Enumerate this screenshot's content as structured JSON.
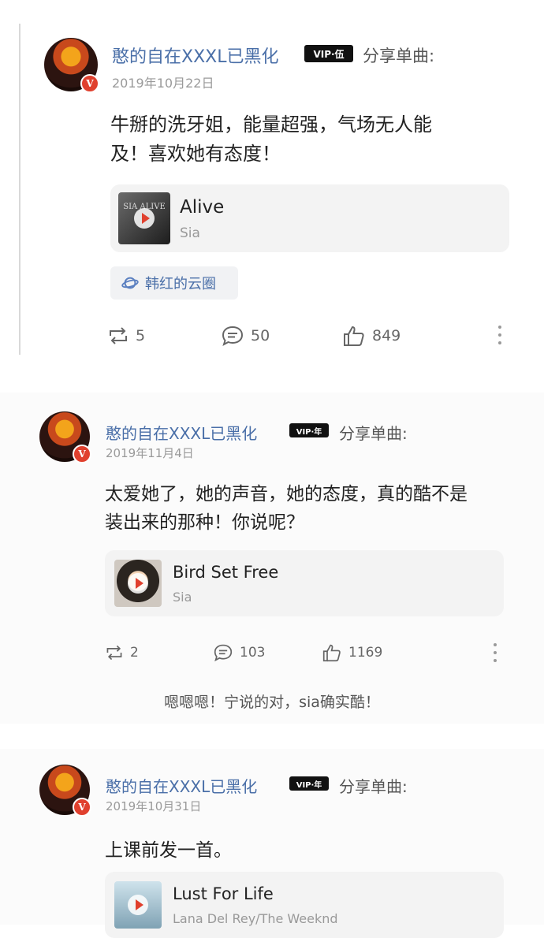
{
  "posts": [
    {
      "username": "憨的自在XXXL已黑化",
      "vip_badge": "VIP·伍",
      "action": "分享单曲:",
      "date": "2019年10月22日",
      "text_line1": "牛掰的洗牙姐，能量超强，气场无人能",
      "text_line2": "及！喜欢她有态度！",
      "song": {
        "title": "Alive",
        "artist": "Sia",
        "cover_text": "SIA ALIVE"
      },
      "circle": "韩红的云圈",
      "reposts": "5",
      "comments": "50",
      "likes": "849"
    },
    {
      "username": "憨的自在XXXL已黑化",
      "vip_badge": "VIP·年",
      "action": "分享单曲:",
      "date": "2019年11月4日",
      "text_line1": "太爱她了，她的声音，她的态度，真的酷不是",
      "text_line2": "装出来的那种！你说呢？",
      "song": {
        "title": "Bird Set Free",
        "artist": "Sia"
      },
      "reposts": "2",
      "comments": "103",
      "likes": "1169"
    },
    {
      "username": "憨的自在XXXL已黑化",
      "vip_badge": "VIP·年",
      "action": "分享单曲:",
      "date": "2019年10月31日",
      "text_line1": "上课前发一首。",
      "song": {
        "title": "Lust For Life",
        "artist": "Lana Del Rey/The Weeknd"
      }
    }
  ],
  "caption": "嗯嗯嗯！宁说的对，sia确实酷！",
  "colors": {
    "username": "#4a6fa8",
    "verified": "#e0402e",
    "card_bg": "#f3f3f3"
  }
}
